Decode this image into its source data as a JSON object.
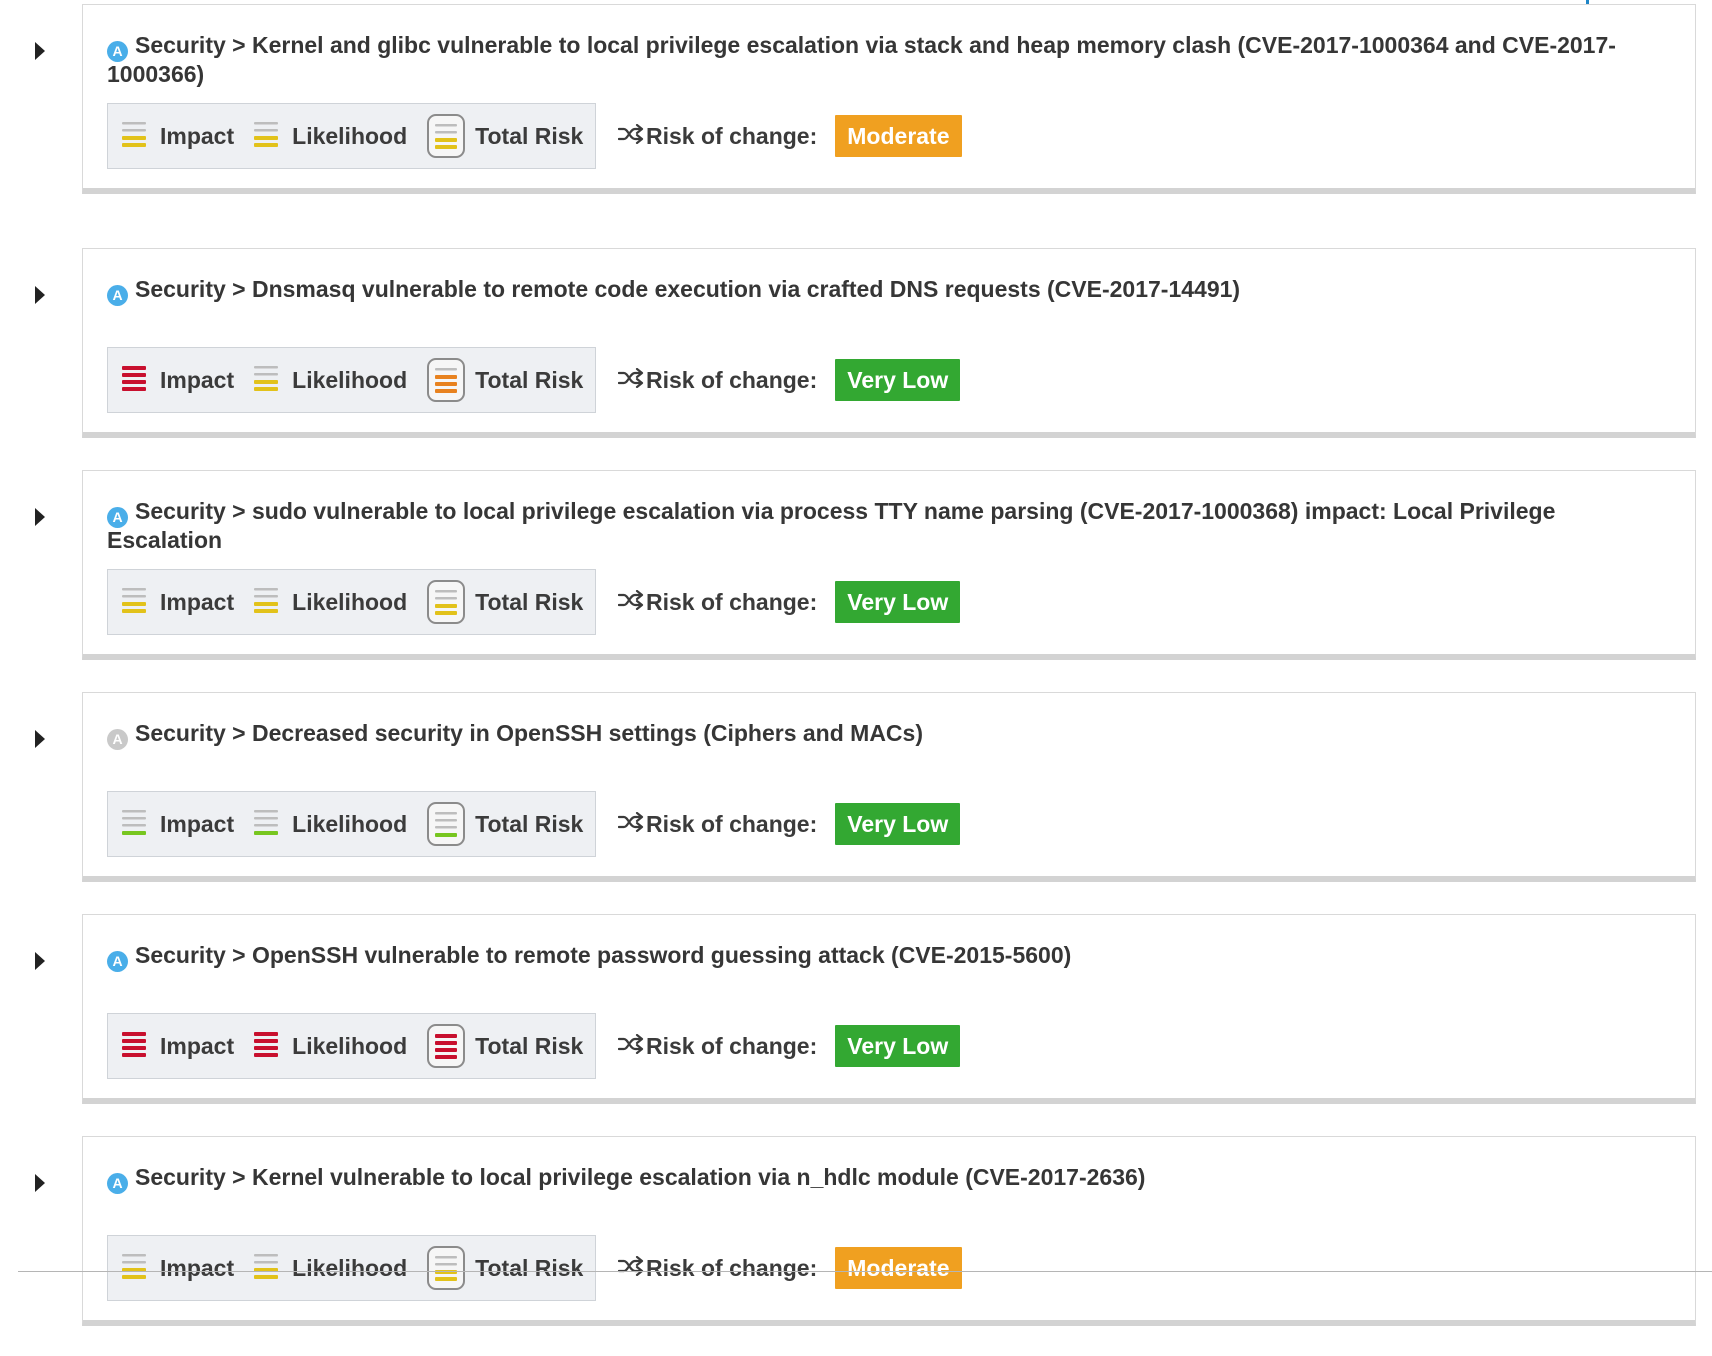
{
  "colors": {
    "severity_red": "#c8102e",
    "severity_orange": "#e8821f",
    "severity_yellow": "#e2c21a",
    "severity_green": "#77c61f",
    "severity_gray": "#bdbdbd",
    "badge_moderate": "#f0a020",
    "badge_very_low": "#33a832",
    "source_icon_blue": "#4aaee9",
    "source_icon_gray": "#c9c9c9"
  },
  "labels": {
    "impact": "Impact",
    "likelihood": "Likelihood",
    "total_risk": "Total Risk",
    "risk_of_change": "Risk of change:"
  },
  "rules": [
    {
      "title": "Security > Kernel and glibc vulnerable to local privilege escalation via stack and heap memory clash (CVE-2017-1000364 and CVE-2017-1000366)",
      "source_icon": "A",
      "source_icon_color": "blue",
      "impact_level": 2,
      "impact_color": "yellow",
      "likelihood_level": 2,
      "likelihood_color": "yellow",
      "total_risk_level": 2,
      "total_risk_color": "yellow",
      "risk_of_change": "Moderate",
      "badge_color": "moderate"
    },
    {
      "title": "Security > Dnsmasq vulnerable to remote code execution via crafted DNS requests (CVE-2017-14491)",
      "source_icon": "A",
      "source_icon_color": "blue",
      "impact_level": 4,
      "impact_color": "red",
      "likelihood_level": 2,
      "likelihood_color": "yellow",
      "total_risk_level": 3,
      "total_risk_color": "orange",
      "risk_of_change": "Very Low",
      "badge_color": "very_low"
    },
    {
      "title": "Security > sudo vulnerable to local privilege escalation via process TTY name parsing (CVE-2017-1000368) impact: Local Privilege Escalation",
      "source_icon": "A",
      "source_icon_color": "blue",
      "impact_level": 2,
      "impact_color": "yellow",
      "likelihood_level": 2,
      "likelihood_color": "yellow",
      "total_risk_level": 2,
      "total_risk_color": "yellow",
      "risk_of_change": "Very Low",
      "badge_color": "very_low"
    },
    {
      "title": "Security > Decreased security in OpenSSH settings (Ciphers and MACs)",
      "source_icon": "A",
      "source_icon_color": "gray",
      "impact_level": 1,
      "impact_color": "green",
      "likelihood_level": 1,
      "likelihood_color": "green",
      "total_risk_level": 1,
      "total_risk_color": "green",
      "risk_of_change": "Very Low",
      "badge_color": "very_low"
    },
    {
      "title": "Security > OpenSSH vulnerable to remote password guessing attack (CVE-2015-5600)",
      "source_icon": "A",
      "source_icon_color": "blue",
      "impact_level": 4,
      "impact_color": "red",
      "likelihood_level": 4,
      "likelihood_color": "red",
      "total_risk_level": 4,
      "total_risk_color": "red",
      "risk_of_change": "Very Low",
      "badge_color": "very_low"
    },
    {
      "title": "Security > Kernel vulnerable to local privilege escalation via n_hdlc module (CVE-2017-2636)",
      "source_icon": "A",
      "source_icon_color": "blue",
      "impact_level": 2,
      "impact_color": "yellow",
      "likelihood_level": 2,
      "likelihood_color": "yellow",
      "total_risk_level": 2,
      "total_risk_color": "yellow",
      "risk_of_change": "Moderate",
      "badge_color": "moderate"
    }
  ]
}
